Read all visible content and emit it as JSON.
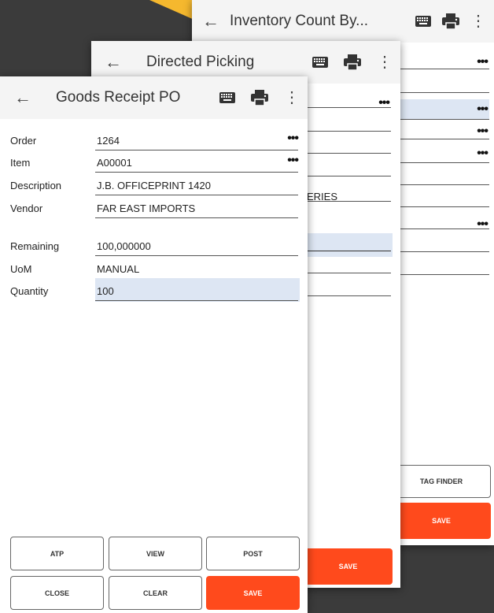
{
  "colors": {
    "accent": "#ff4a1c",
    "highlight": "#dde6f3",
    "wedge": "#f5b82e",
    "background": "#3b3b3b"
  },
  "screens": {
    "inventory_count": {
      "title": "Inventory Count By...",
      "tag_finder_label": "TAG FINDER",
      "save_label": "SAVE"
    },
    "directed_picking": {
      "title": "Directed Picking",
      "partial_value": "ERIES",
      "save_label": "SAVE"
    },
    "goods_receipt": {
      "title": "Goods Receipt PO",
      "fields": {
        "order": {
          "label": "Order",
          "value": "1264"
        },
        "item": {
          "label": "Item",
          "value": "A00001"
        },
        "description": {
          "label": "Description",
          "value": "J.B. OFFICEPRINT 1420"
        },
        "vendor": {
          "label": "Vendor",
          "value": "FAR EAST IMPORTS"
        },
        "remaining": {
          "label": "Remaining",
          "value": "100,000000"
        },
        "uom": {
          "label": "UoM",
          "value": "MANUAL"
        },
        "quantity": {
          "label": "Quantity",
          "value": "100"
        }
      },
      "more_label": "•••",
      "buttons": {
        "atp": "ATP",
        "view": "VIEW",
        "post": "POST",
        "close": "CLOSE",
        "clear": "CLEAR",
        "save": "SAVE"
      }
    }
  }
}
